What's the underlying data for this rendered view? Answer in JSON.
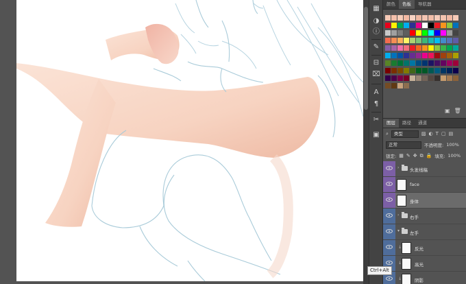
{
  "panels": {
    "swatch_tabs": [
      "颜色",
      "色板",
      "导航器"
    ],
    "swatch_active": 1,
    "layer_tabs": [
      "图层",
      "路径",
      "通道"
    ],
    "layer_active": 0,
    "filter_kind": "类型",
    "blend_mode": "正常",
    "opacity_label": "不透明度:",
    "opacity_value": "100%",
    "lock_label": "锁定:",
    "fill_label": "填充:",
    "fill_value": "100%"
  },
  "swatch_rows": [
    [
      "#f5c9b6",
      "#f3c0ab",
      "#f6cdb9",
      "#f2b9a3",
      "#f7d2c2",
      "#efb7a1",
      "#f4c5b2",
      "#f1bda8",
      "#f6ccba",
      "#f3c3af",
      "#f0b9a4",
      "#f5cab7"
    ],
    [
      "#e8001c",
      "#fff200",
      "#00a651",
      "#00aeef",
      "#2e3192",
      "#ec008c",
      "#ffffff",
      "#000000",
      "#ed1c24",
      "#f7941d",
      "#8dc63f",
      "#0072bc"
    ],
    [
      "#c8c8c8",
      "#a0a0a0",
      "#7d7d7d",
      "#5e5e5e",
      "#ff0000",
      "#ffff00",
      "#00ff00",
      "#00ffff",
      "#0000ff",
      "#ff00ff",
      "#9b9b9b",
      "#444444"
    ],
    [
      "#f26c4f",
      "#f68e55",
      "#fbaf5c",
      "#fff467",
      "#acd372",
      "#7cc576",
      "#3bb878",
      "#1abbb4",
      "#00bff3",
      "#438ccb",
      "#5574b9",
      "#605ca8"
    ],
    [
      "#8560a8",
      "#a763a8",
      "#f06ea9",
      "#f26d7d",
      "#ed1c24",
      "#f26522",
      "#f7941d",
      "#fff200",
      "#8dc63f",
      "#39b54a",
      "#00a651",
      "#00a99d"
    ],
    [
      "#00aeef",
      "#0072bc",
      "#0054a6",
      "#2e3192",
      "#662d91",
      "#92278f",
      "#ec008c",
      "#ed145b",
      "#9e0b0f",
      "#a0410d",
      "#a36209",
      "#aba000"
    ],
    [
      "#598527",
      "#1a7b30",
      "#007236",
      "#00746b",
      "#0076a3",
      "#004b80",
      "#003471",
      "#1b1464",
      "#440e62",
      "#630460",
      "#9e005d",
      "#9e0039"
    ],
    [
      "#790000",
      "#7b2e00",
      "#7d4900",
      "#827b00",
      "#406618",
      "#005e20",
      "#005826",
      "#005952",
      "#005b7f",
      "#003663",
      "#002157",
      "#0d004c"
    ],
    [
      "#32004b",
      "#4b0049",
      "#7b0046",
      "#7a0026",
      "#c7b299",
      "#998675",
      "#736357",
      "#534741",
      "#37302d",
      "#c69c6d",
      "#a67c52",
      "#8c6239"
    ],
    [
      "#754c24",
      "#603913",
      "#c8a27c",
      "#8d6e4f"
    ]
  ],
  "layers": [
    {
      "name": "头发线稿",
      "type": "group",
      "clipped": false,
      "selected": false
    },
    {
      "name": "face",
      "type": "layer",
      "clipped": false,
      "selected": false
    },
    {
      "name": "身体",
      "type": "layer",
      "clipped": false,
      "selected": true
    },
    {
      "name": "右手",
      "type": "group",
      "clipped": false,
      "selected": false
    },
    {
      "name": "左手",
      "type": "group",
      "clipped": false,
      "selected": false
    },
    {
      "name": "反光",
      "type": "layer",
      "clipped": true,
      "selected": false
    },
    {
      "name": "高光",
      "type": "layer",
      "clipped": true,
      "selected": false
    },
    {
      "name": "阴影",
      "type": "layer",
      "clipped": true,
      "selected": false
    }
  ],
  "layer_colors": {
    "purple": "#7c5fa6",
    "blue": "#4f6d9b"
  },
  "tooltip": "Ctrl+Alt",
  "colors": {
    "skin": "#f8d6c4",
    "skin_shadow": "#eeb7a0",
    "lineart": "#a9cbd9"
  }
}
